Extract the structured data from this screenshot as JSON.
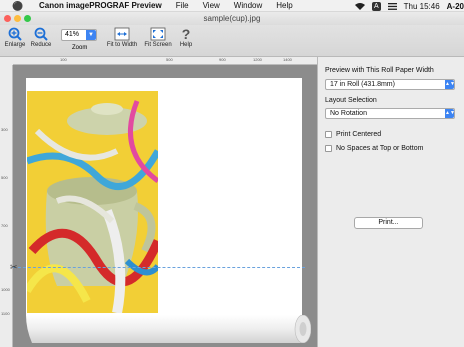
{
  "menubar": {
    "app_name": "Canon imagePROGRAF Preview",
    "menus": [
      "File",
      "View",
      "Window",
      "Help"
    ],
    "clock": "Thu 15:46",
    "input_badge": "A",
    "truncated_extra": "A-20"
  },
  "window": {
    "title": "sample(cup).jpg"
  },
  "toolbar": {
    "enlarge_label": "Enlarge",
    "reduce_label": "Reduce",
    "zoom_value": "41%",
    "zoom_label": "Zoom",
    "fit_width_label": "Fit to Width",
    "fit_screen_label": "Fit Screen",
    "help_label": "Help",
    "help_glyph": "?"
  },
  "ruler": {
    "top_ticks": [
      "100",
      "200",
      "300",
      "400",
      "500",
      "600",
      "700",
      "800",
      "900",
      "1000",
      "1100",
      "1200",
      "1300",
      "1400"
    ],
    "left_ticks": [
      "100",
      "200",
      "300",
      "400",
      "500",
      "600",
      "700",
      "800",
      "900",
      "1000",
      "1100"
    ]
  },
  "panel": {
    "roll_paper_label": "Preview with This Roll Paper Width",
    "roll_paper_value": "17 in Roll (431.8mm)",
    "layout_label": "Layout Selection",
    "layout_value": "No Rotation",
    "print_centered_label": "Print Centered",
    "print_centered_checked": false,
    "no_spaces_label": "No Spaces at Top or Bottom",
    "no_spaces_checked": false,
    "print_button_label": "Print..."
  },
  "colors": {
    "accent": "#3d84f2",
    "preview_background": "#8c8c8c",
    "cut_line": "#6aa2dd"
  }
}
